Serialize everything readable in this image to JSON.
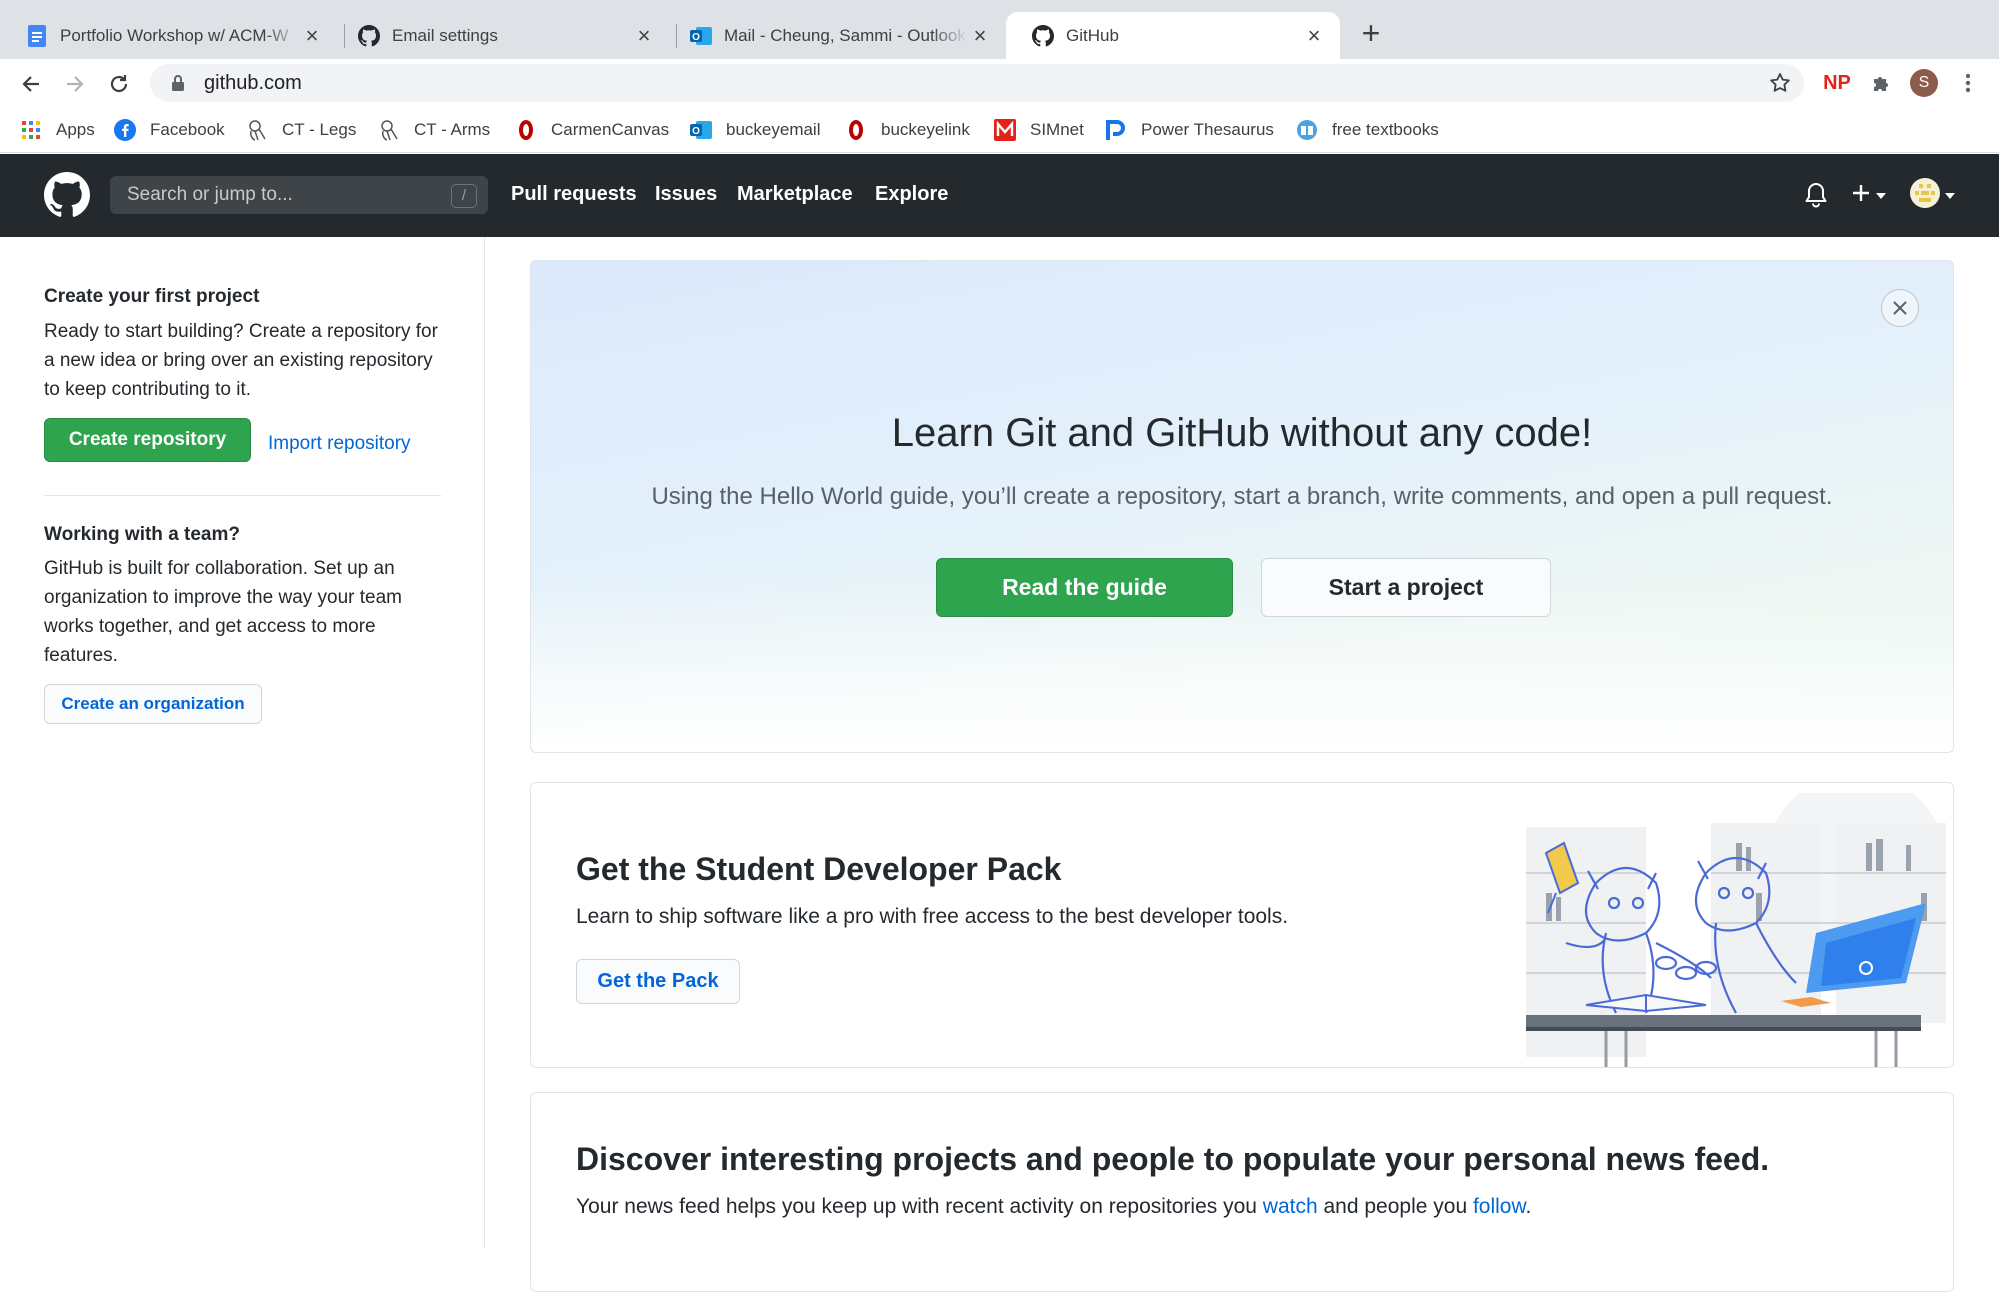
{
  "browser": {
    "tabs": [
      {
        "label": "Portfolio Workshop w/ ACM-W",
        "icon": "docs-icon"
      },
      {
        "label": "Email settings",
        "icon": "github-icon"
      },
      {
        "label": "Mail - Cheung, Sammi - Outlook",
        "icon": "outlook-icon"
      },
      {
        "label": "GitHub",
        "icon": "github-icon",
        "active": true
      }
    ],
    "url": "github.com",
    "profile_initial": "S",
    "extension_np": "NP",
    "bookmarks": [
      {
        "label": "Apps",
        "icon": "apps-grid-icon"
      },
      {
        "label": "Facebook",
        "icon": "facebook-icon"
      },
      {
        "label": "CT - Legs",
        "icon": "anatomy-icon"
      },
      {
        "label": "CT - Arms",
        "icon": "anatomy-icon"
      },
      {
        "label": "CarmenCanvas",
        "icon": "osu-icon"
      },
      {
        "label": "buckeyemail",
        "icon": "outlook-icon"
      },
      {
        "label": "buckeyelink",
        "icon": "osu-icon"
      },
      {
        "label": "SIMnet",
        "icon": "simnet-icon"
      },
      {
        "label": "Power Thesaurus",
        "icon": "power-thesaurus-icon"
      },
      {
        "label": "free textbooks",
        "icon": "textbook-icon"
      }
    ]
  },
  "github": {
    "search_placeholder": "Search or jump to...",
    "search_shortcut": "/",
    "nav": [
      "Pull requests",
      "Issues",
      "Marketplace",
      "Explore"
    ],
    "colors": {
      "header": "#24292e",
      "primary": "#2ea44f",
      "link": "#0366d6"
    }
  },
  "sidebar": {
    "first_project": {
      "title": "Create your first project",
      "text": "Ready to start building? Create a repository for a new idea or bring over an existing repository to keep contributing to it.",
      "create_button": "Create repository",
      "import_link": "Import repository"
    },
    "team": {
      "title": "Working with a team?",
      "text": "GitHub is built for collaboration. Set up an organization to improve the way your team works together, and get access to more features.",
      "org_button": "Create an organization"
    }
  },
  "hero": {
    "title": "Learn Git and GitHub without any code!",
    "subtitle": "Using the Hello World guide, you’ll create a repository, start a branch, write comments, and open a pull request.",
    "primary_button": "Read the guide",
    "secondary_button": "Start a project"
  },
  "student_pack": {
    "title": "Get the Student Developer Pack",
    "text": "Learn to ship software like a pro with free access to the best developer tools.",
    "button": "Get the Pack"
  },
  "discover": {
    "title": "Discover interesting projects and people to populate your personal news feed.",
    "text_before": "Your news feed helps you keep up with recent activity on repositories you ",
    "watch_link": "watch",
    "text_middle": " and people you ",
    "follow_link": "follow",
    "text_after": "."
  }
}
